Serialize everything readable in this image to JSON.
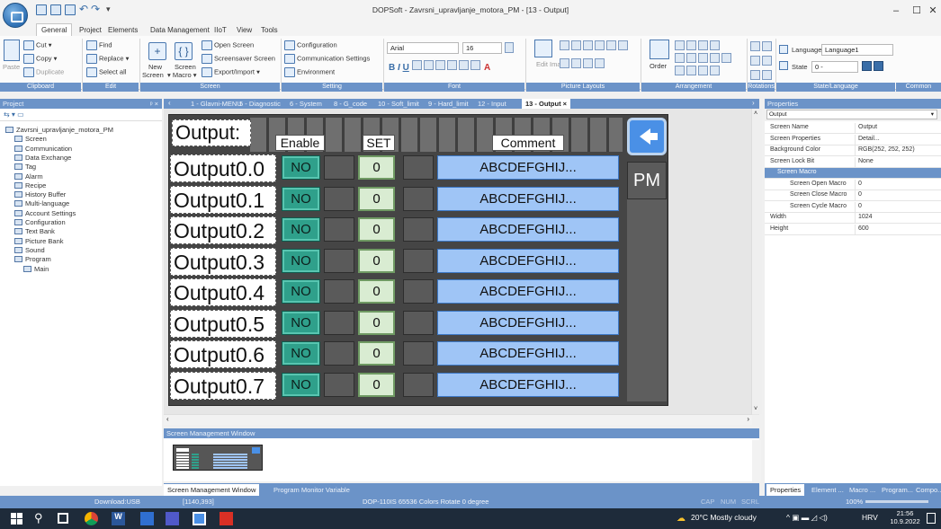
{
  "window": {
    "title": "DOPSoft - Zavrsni_upravljanje_motora_PM - [13 - Output]",
    "controls": [
      "–",
      "☐",
      "✕"
    ]
  },
  "menu_tabs": [
    "General",
    "Project",
    "Elements",
    "Data Management",
    "IIoT",
    "View",
    "Tools"
  ],
  "ribbon": {
    "clipboard": {
      "cut": "Cut",
      "copy": "Copy",
      "paste": "Paste",
      "duplicate": "Duplicate",
      "label": "Clipboard"
    },
    "edit": {
      "find": "Find",
      "replace": "Replace",
      "select_all": "Select all",
      "label": "Edit"
    },
    "screen": {
      "new_screen": "New Screen",
      "screen_macro": "Screen Macro",
      "open_screen": "Open Screen",
      "screensaver": "Screensaver Screen",
      "export_import": "Export/Import",
      "label": "Screen",
      "new": "New",
      "screen_word": "Screen"
    },
    "setting": {
      "configuration": "Configuration",
      "communication": "Communication Settings",
      "environment": "Environment",
      "label": "Setting"
    },
    "font": {
      "family": "Arial",
      "size": "16",
      "label": "Font"
    },
    "picture_layouts": {
      "edit_image": "Edit Image",
      "label": "Picture Layouts"
    },
    "arrangement": {
      "order": "Order",
      "label": "Arrangement"
    },
    "rotations": {
      "label": "Rotations"
    },
    "state_language": {
      "language_label": "Language",
      "language_value": "Language1",
      "state_label": "State",
      "state_value": "0 -",
      "label": "State/Language"
    },
    "common": {
      "label": "Common"
    }
  },
  "project": {
    "header": "Project",
    "tree": [
      {
        "label": "Zavrsni_upravljanje_motora_PM",
        "level": 0
      },
      {
        "label": "Screen",
        "level": 1
      },
      {
        "label": "Communication",
        "level": 1
      },
      {
        "label": "Data Exchange",
        "level": 1
      },
      {
        "label": "Tag",
        "level": 1
      },
      {
        "label": "Alarm",
        "level": 1
      },
      {
        "label": "Recipe",
        "level": 1
      },
      {
        "label": "History Buffer",
        "level": 1
      },
      {
        "label": "Multi-language",
        "level": 1
      },
      {
        "label": "Account Settings",
        "level": 1
      },
      {
        "label": "Configuration",
        "level": 1
      },
      {
        "label": "Text Bank",
        "level": 1
      },
      {
        "label": "Picture Bank",
        "level": 1
      },
      {
        "label": "Sound",
        "level": 1
      },
      {
        "label": "Program",
        "level": 1
      },
      {
        "label": "Main",
        "level": 2
      }
    ]
  },
  "doc_tabs": [
    {
      "label": "1 - Glavni-MENU"
    },
    {
      "label": "5 - Diagnostic"
    },
    {
      "label": "6 - System"
    },
    {
      "label": "8 - G_code"
    },
    {
      "label": "10 - Soft_limit"
    },
    {
      "label": "9 - Hard_limit"
    },
    {
      "label": "12 - Input"
    },
    {
      "label": "13 - Output ×",
      "active": true
    }
  ],
  "hmi": {
    "title": "Output:",
    "headers": {
      "enable": "Enable",
      "set": "SET",
      "comment": "Comment"
    },
    "pm_label": "PM",
    "rows": [
      {
        "name": "Output0.0",
        "enable": "NO",
        "set": "0",
        "comment": "ABCDEFGHIJ..."
      },
      {
        "name": "Output0.1",
        "enable": "NO",
        "set": "0",
        "comment": "ABCDEFGHIJ..."
      },
      {
        "name": "Output0.2",
        "enable": "NO",
        "set": "0",
        "comment": "ABCDEFGHIJ..."
      },
      {
        "name": "Output0.3",
        "enable": "NO",
        "set": "0",
        "comment": "ABCDEFGHIJ..."
      },
      {
        "name": "Output0.4",
        "enable": "NO",
        "set": "0",
        "comment": "ABCDEFGHIJ..."
      },
      {
        "name": "Output0.5",
        "enable": "NO",
        "set": "0",
        "comment": "ABCDEFGHIJ..."
      },
      {
        "name": "Output0.6",
        "enable": "NO",
        "set": "0",
        "comment": "ABCDEFGHIJ..."
      },
      {
        "name": "Output0.7",
        "enable": "NO",
        "set": "0",
        "comment": "ABCDEFGHIJ..."
      }
    ]
  },
  "properties": {
    "header": "Properties",
    "selected_object": "Output",
    "rows": [
      {
        "name": "Screen Name",
        "value": "Output"
      },
      {
        "name": "Screen Properties",
        "value": "Detail..."
      },
      {
        "name": "Background Color",
        "value": "RGB(252, 252, 252)"
      },
      {
        "name": "Screen Lock Bit",
        "value": "None"
      },
      {
        "name": "Screen Macro",
        "value": "",
        "section": true
      },
      {
        "name": "Screen Open Macro",
        "value": "0",
        "indent": true
      },
      {
        "name": "Screen Close Macro",
        "value": "0",
        "indent": true
      },
      {
        "name": "Screen Cycle Macro",
        "value": "0",
        "indent": true
      },
      {
        "name": "Width",
        "value": "1024"
      },
      {
        "name": "Height",
        "value": "600"
      }
    ],
    "bottom_tabs": [
      "Properties",
      "Element ...",
      "Macro ...",
      "Program...",
      "Compo..."
    ]
  },
  "screen_mgmt": {
    "header": "Screen Management Window",
    "tabs": [
      "Screen Management Window",
      "Program Monitor Variable"
    ]
  },
  "status": {
    "download": "Download:USB",
    "coords": "[1140,393]",
    "device": "DOP-110IS 65536 Colors Rotate 0 degree",
    "caps": "CAP",
    "num": "NUM",
    "scrl": "SCRL",
    "zoom": "100%"
  },
  "taskbar": {
    "weather": "20°C  Mostly cloudy",
    "lang": "HRV",
    "time": "21:56",
    "date": "10.9.2022"
  },
  "colors": {
    "ribbon_accent": "#6b93c8",
    "hmi_bg": "#454545",
    "no_button": "#2fa08b",
    "comment_box": "#9fc5f6",
    "set_box": "#d9ecd2"
  }
}
